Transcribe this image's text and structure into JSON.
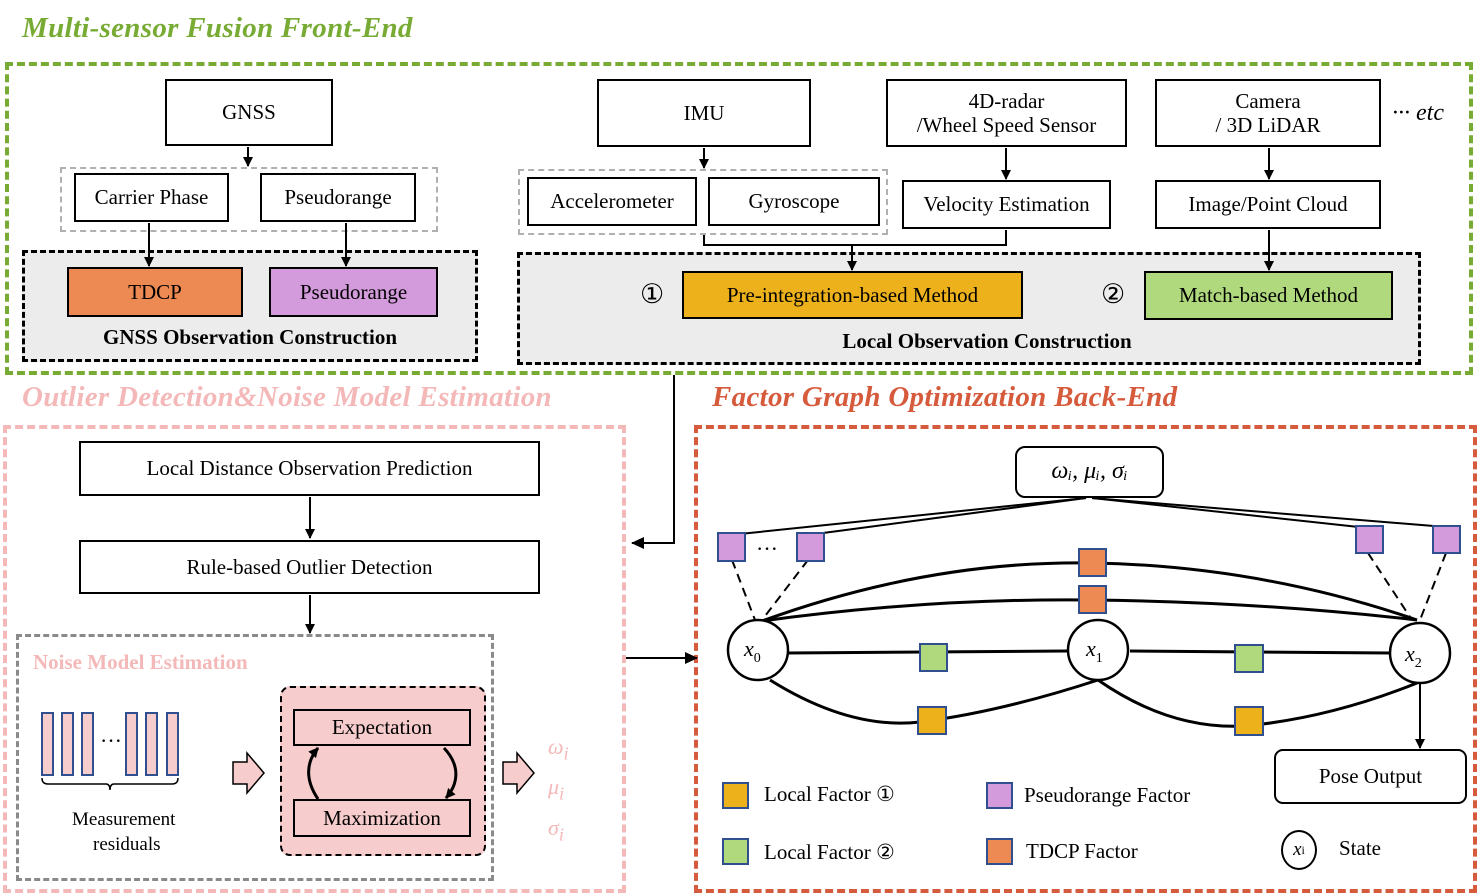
{
  "front_end": {
    "title": "Multi-sensor Fusion Front-End",
    "gnss": {
      "source": "GNSS",
      "carrier_phase": "Carrier Phase",
      "pseudorange_raw": "Pseudorange",
      "tdcp": "TDCP",
      "pseudorange": "Pseudorange",
      "group_label": "GNSS Observation Construction"
    },
    "local": {
      "imu": "IMU",
      "radar_line1": "4D-radar",
      "radar_line2": "/Wheel Speed Sensor",
      "camera_line1": "Camera",
      "camera_line2": "/ 3D LiDAR",
      "etc": "··· etc",
      "accelerometer": "Accelerometer",
      "gyroscope": "Gyroscope",
      "velocity_estimation": "Velocity Estimation",
      "image_point_cloud": "Image/Point Cloud",
      "method1_marker": "①",
      "method1": "Pre-integration-based Method",
      "method2_marker": "②",
      "method2": "Match-based Method",
      "group_label": "Local Observation Construction"
    }
  },
  "outlier": {
    "title": "Outlier Detection&Noise Model Estimation",
    "prediction": "Local Distance Observation Prediction",
    "detection": "Rule-based Outlier Detection",
    "noise_title": "Noise Model Estimation",
    "residual_dots": "···",
    "residual_label_1": "Measurement",
    "residual_label_2": "residuals",
    "expectation": "Expectation",
    "maximization": "Maximization",
    "outputs": [
      "ω",
      "μ",
      "σ"
    ],
    "output_subscript": "i"
  },
  "back_end": {
    "title": "Factor Graph Optimization Back-End",
    "params_label": "ωᵢ, μᵢ, σᵢ",
    "states": [
      {
        "symbol": "x",
        "sub": "0"
      },
      {
        "symbol": "x",
        "sub": "1"
      },
      {
        "symbol": "x",
        "sub": "2"
      }
    ],
    "dots": "···",
    "pose_output": "Pose Output",
    "legend": {
      "local1": "Local Factor ①",
      "local2": "Local Factor ②",
      "pseudorange": "Pseudorange Factor",
      "tdcp": "TDCP Factor",
      "state_symbol": "x",
      "state_sub": "i",
      "state": "State"
    }
  },
  "colors": {
    "front_end": "#77ab34",
    "outlier": "#f4b8b8",
    "back_end": "#d65a3c",
    "tdcp": "#ed8953",
    "pseudorange": "#d49bdc",
    "local1": "#edb11b",
    "local2": "#b0d97e",
    "residual_fill": "#f6cccc",
    "residual_border": "#2f4f8f",
    "obs_bg": "#ececec"
  }
}
